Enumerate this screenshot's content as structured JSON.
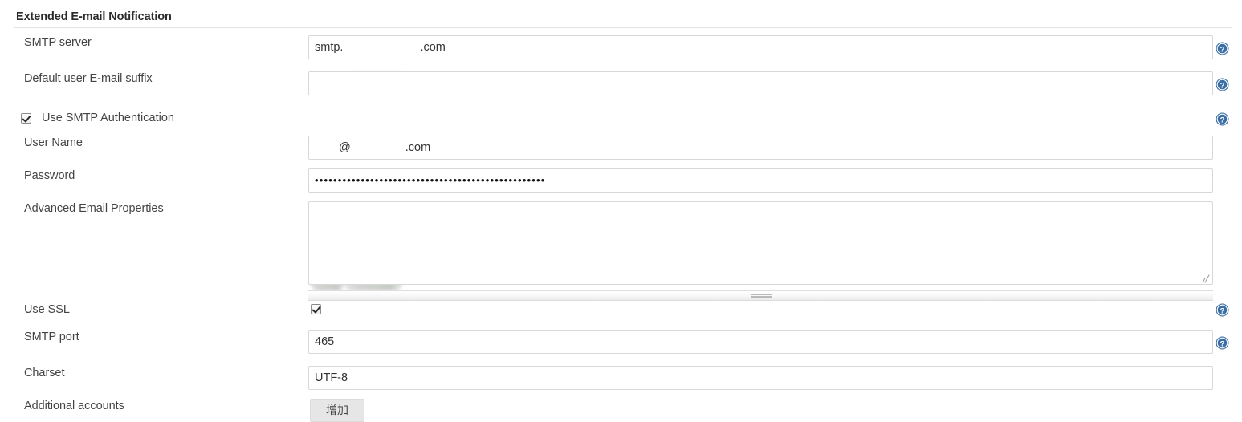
{
  "section": {
    "title": "Extended E-mail Notification"
  },
  "fields": {
    "smtp_server": {
      "label": "SMTP server",
      "value_prefix": "smtp.",
      "value_suffix": ".com",
      "redacted": true,
      "has_help": true
    },
    "default_suffix": {
      "label": "Default user E-mail suffix",
      "value": "",
      "has_help": true
    },
    "use_smtp_auth": {
      "label": "Use SMTP Authentication",
      "checked": true,
      "has_help": true
    },
    "user_name": {
      "label": "User Name",
      "value_prefix": "",
      "value_middle": "@",
      "value_suffix": ".com",
      "redacted": true,
      "has_help": false
    },
    "password": {
      "label": "Password",
      "value": "••••••••••••••••••••••••••••••••••••••••••••••••••",
      "has_help": false
    },
    "advanced_email_properties": {
      "label": "Advanced Email Properties",
      "value": "",
      "has_help": false
    },
    "use_ssl": {
      "label": "Use SSL",
      "checked": true,
      "has_help": true
    },
    "smtp_port": {
      "label": "SMTP port",
      "value": "465",
      "has_help": true
    },
    "charset": {
      "label": "Charset",
      "value": "UTF-8",
      "has_help": false
    },
    "additional_accounts": {
      "label": "Additional accounts",
      "button_label": "增加",
      "has_help": false
    }
  },
  "icons": {
    "help": "help-circle-icon",
    "splitter": "drag-grip-icon",
    "resize": "resize-handle-icon"
  },
  "colors": {
    "help_blue": "#3b6ea5",
    "border": "#d8d8d8",
    "text": "#444444",
    "button_bg": "#e6e6e6"
  }
}
